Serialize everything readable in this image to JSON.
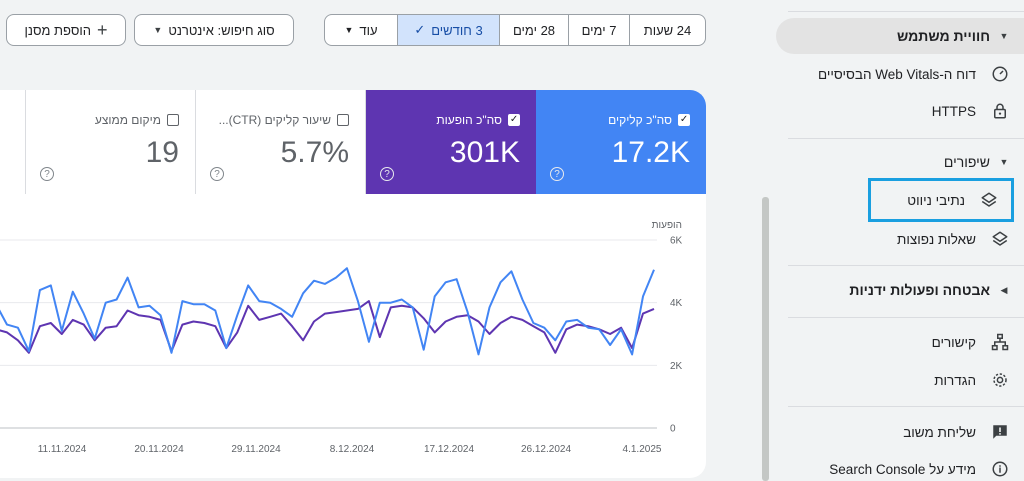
{
  "toolbar": {
    "add_filter": "הוספת מסנן",
    "search_type": "סוג חיפוש: אינטרנט",
    "ranges": [
      "24 שעות",
      "7 ימים",
      "28 ימים",
      "3 חודשים",
      "עוד"
    ],
    "active_range": "3 חודשים"
  },
  "metrics": {
    "clicks": {
      "label": "סה\"כ קליקים",
      "value": "17.2K",
      "checked": true,
      "color": "#4285f4"
    },
    "impressions": {
      "label": "סה\"כ הופעות",
      "value": "301K",
      "checked": true,
      "color": "#5e35b1"
    },
    "ctr": {
      "label": "שיעור קליקים (CTR)...",
      "value": "5.7%",
      "checked": false
    },
    "position": {
      "label": "מיקום ממוצע",
      "value": "19",
      "checked": false
    }
  },
  "chart_data": {
    "type": "line",
    "ylabel": "הופעות",
    "y_ticks": [
      "6K",
      "4K",
      "2K",
      "0"
    ],
    "ylim": [
      0,
      6000
    ],
    "x_tick_labels": [
      "11.11.2024",
      "20.11.2024",
      "29.11.2024",
      "8.12.2024",
      "17.12.2024",
      "26.12.2024",
      "4.1.2025"
    ],
    "grid": true,
    "series": [
      {
        "name": "סה\"כ קליקים",
        "color": "#4285f4",
        "values": [
          3950,
          3300,
          3200,
          2450,
          4400,
          4550,
          3100,
          4350,
          3650,
          2850,
          4000,
          4100,
          4800,
          3850,
          3900,
          3600,
          2400,
          4050,
          3950,
          3950,
          3750,
          2550,
          3600,
          4550,
          4050,
          4000,
          3800,
          3550,
          4300,
          4700,
          4600,
          4800,
          5100,
          4050,
          2750,
          4000,
          4000,
          4100,
          3850,
          2500,
          4200,
          4650,
          4750,
          3700,
          2350,
          3850,
          4650,
          5000,
          4100,
          3350,
          3200,
          2800,
          3400,
          3450,
          3200,
          3150,
          2650,
          3150,
          2350,
          4200,
          5050
        ]
      },
      {
        "name": "סה\"כ הופעות",
        "color": "#5e35b1",
        "values": [
          3150,
          3050,
          2800,
          2400,
          3250,
          3350,
          3000,
          3450,
          3300,
          2800,
          3200,
          3250,
          3750,
          3600,
          3550,
          3450,
          2450,
          3300,
          3400,
          3350,
          3250,
          2550,
          3050,
          3900,
          3450,
          3550,
          3650,
          3250,
          2800,
          3400,
          3650,
          3700,
          3750,
          3800,
          4050,
          2900,
          3850,
          3900,
          3850,
          3500,
          3050,
          3400,
          3550,
          3600,
          3400,
          3000,
          3350,
          3550,
          3450,
          3250,
          3050,
          2400,
          3150,
          3300,
          3250,
          3150,
          3000,
          3200,
          2550,
          3650,
          3800
        ]
      }
    ]
  },
  "nav": {
    "user_experience": "חוויית משתמש",
    "web_vitals": "דוח ה-Web Vitals הבסיסיים",
    "https": "HTTPS",
    "enhancements": "שיפורים",
    "breadcrumbs": "נתיבי ניווט",
    "faq": "שאלות נפוצות",
    "security": "אבטחה ופעולות ידניות",
    "links": "קישורים",
    "settings": "הגדרות",
    "feedback": "שליחת משוב",
    "about": "מידע על Search Console"
  },
  "colors": {
    "accent": "#4285f4",
    "purple": "#5e35b1",
    "selection": "#1a9fe0"
  },
  "icons": [
    "plus-icon",
    "caret-down-icon",
    "check-icon",
    "help-icon",
    "gauge-icon",
    "lock-icon",
    "layers-icon",
    "sitemap-icon",
    "gear-icon",
    "feedback-icon",
    "info-icon"
  ]
}
